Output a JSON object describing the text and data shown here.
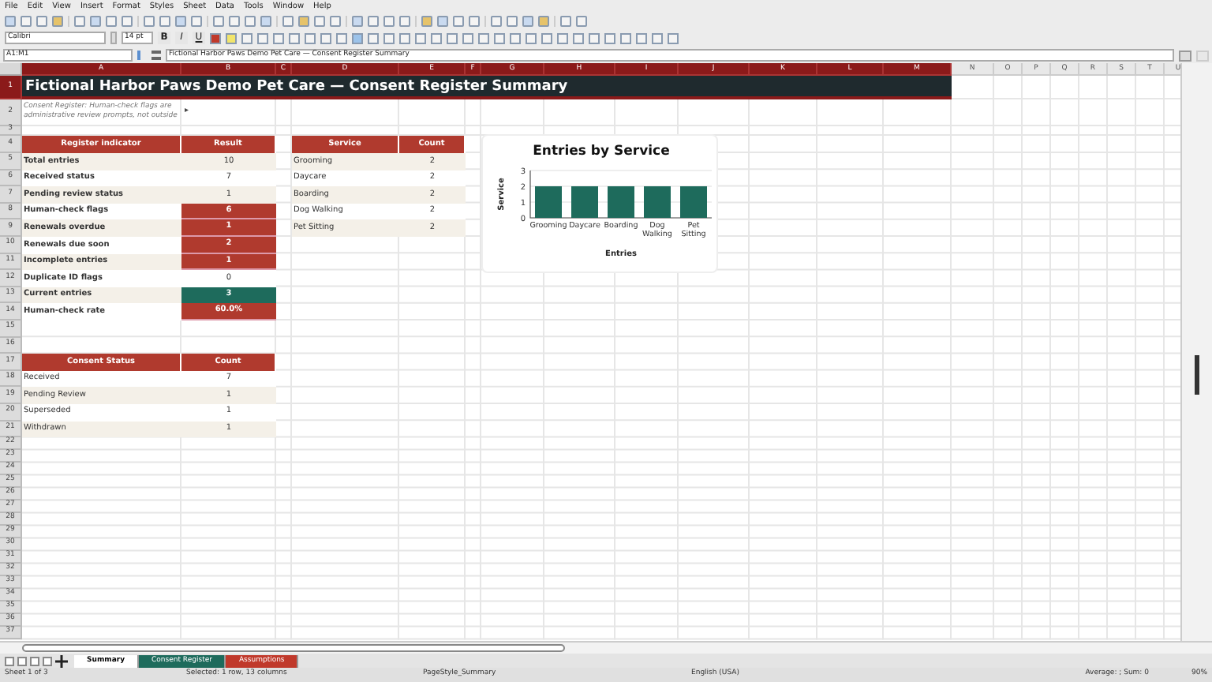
{
  "menu": [
    "File",
    "Edit",
    "View",
    "Insert",
    "Format",
    "Styles",
    "Sheet",
    "Data",
    "Tools",
    "Window",
    "Help"
  ],
  "font_name": "Calibri",
  "font_size": "14 pt",
  "format_buttons": [
    "B",
    "I",
    "U"
  ],
  "name_box": "A1:M1",
  "formula": "Fictional Harbor Paws Demo Pet Care — Consent Register Summary",
  "columns": [
    {
      "label": "A",
      "selected": true
    },
    {
      "label": "B",
      "selected": true
    },
    {
      "label": "C",
      "selected": true
    },
    {
      "label": "D",
      "selected": true
    },
    {
      "label": "E",
      "selected": true
    },
    {
      "label": "F",
      "selected": true
    },
    {
      "label": "G",
      "selected": true
    },
    {
      "label": "H",
      "selected": true
    },
    {
      "label": "I",
      "selected": true
    },
    {
      "label": "J",
      "selected": true
    },
    {
      "label": "K",
      "selected": true
    },
    {
      "label": "L",
      "selected": true
    },
    {
      "label": "M",
      "selected": true
    },
    {
      "label": "N",
      "selected": false
    },
    {
      "label": "O",
      "selected": false
    },
    {
      "label": "P",
      "selected": false
    },
    {
      "label": "Q",
      "selected": false
    },
    {
      "label": "R",
      "selected": false
    },
    {
      "label": "S",
      "selected": false
    },
    {
      "label": "T",
      "selected": false
    },
    {
      "label": "U",
      "selected": false
    }
  ],
  "rows": [
    {
      "label": "1",
      "selected": true
    },
    {
      "label": "2",
      "selected": false
    },
    {
      "label": "3",
      "selected": false
    },
    {
      "label": "4",
      "selected": false
    },
    {
      "label": "5",
      "selected": false
    },
    {
      "label": "6",
      "selected": false
    },
    {
      "label": "7",
      "selected": false
    },
    {
      "label": "8",
      "selected": false
    },
    {
      "label": "9",
      "selected": false
    },
    {
      "label": "10",
      "selected": false
    },
    {
      "label": "11",
      "selected": false
    },
    {
      "label": "12",
      "selected": false
    },
    {
      "label": "13",
      "selected": false
    },
    {
      "label": "14",
      "selected": false
    },
    {
      "label": "15",
      "selected": false
    },
    {
      "label": "16",
      "selected": false
    },
    {
      "label": "17",
      "selected": false
    },
    {
      "label": "18",
      "selected": false
    },
    {
      "label": "19",
      "selected": false
    },
    {
      "label": "20",
      "selected": false
    },
    {
      "label": "21",
      "selected": false
    },
    {
      "label": "22",
      "selected": false
    },
    {
      "label": "23",
      "selected": false
    },
    {
      "label": "24",
      "selected": false
    },
    {
      "label": "25",
      "selected": false
    },
    {
      "label": "26",
      "selected": false
    },
    {
      "label": "27",
      "selected": false
    },
    {
      "label": "28",
      "selected": false
    },
    {
      "label": "29",
      "selected": false
    },
    {
      "label": "30",
      "selected": false
    },
    {
      "label": "31",
      "selected": false
    },
    {
      "label": "32",
      "selected": false
    },
    {
      "label": "33",
      "selected": false
    },
    {
      "label": "34",
      "selected": false
    },
    {
      "label": "35",
      "selected": false
    },
    {
      "label": "36",
      "selected": false
    },
    {
      "label": "37",
      "selected": false
    }
  ],
  "title": "Fictional Harbor Paws Demo Pet Care — Consent Register Summary",
  "note": "Consent Register: Human-check flags are administrative review prompts, not outside",
  "note_marker": "▸",
  "indicator_table": {
    "columns": [
      "Register indicator",
      "Result"
    ],
    "rows": [
      {
        "label": "Total entries",
        "value": "10",
        "kind": "plain"
      },
      {
        "label": "Received status",
        "value": "7",
        "kind": "plain"
      },
      {
        "label": "Pending review status",
        "value": "1",
        "kind": "plain"
      },
      {
        "label": "Human-check flags",
        "value": "6",
        "kind": "alert"
      },
      {
        "label": "Renewals overdue",
        "value": "1",
        "kind": "alert"
      },
      {
        "label": "Renewals due soon",
        "value": "2",
        "kind": "alert"
      },
      {
        "label": "Incomplete entries",
        "value": "1",
        "kind": "alert"
      },
      {
        "label": "Duplicate ID flags",
        "value": "0",
        "kind": "plain"
      },
      {
        "label": "Current entries",
        "value": "3",
        "kind": "good"
      },
      {
        "label": "Human-check rate",
        "value": "60.0%",
        "kind": "alert"
      }
    ]
  },
  "service_table": {
    "columns": [
      "Service",
      "Count"
    ],
    "rows": [
      {
        "label": "Grooming",
        "value": "2"
      },
      {
        "label": "Daycare",
        "value": "2"
      },
      {
        "label": "Boarding",
        "value": "2"
      },
      {
        "label": "Dog Walking",
        "value": "2"
      },
      {
        "label": "Pet Sitting",
        "value": "2"
      }
    ]
  },
  "consent_table": {
    "columns": [
      "Consent Status",
      "Count"
    ],
    "rows": [
      {
        "label": "Received",
        "value": "7"
      },
      {
        "label": "Pending Review",
        "value": "1"
      },
      {
        "label": "Superseded",
        "value": "1"
      },
      {
        "label": "Withdrawn",
        "value": "1"
      }
    ]
  },
  "chart_data": {
    "type": "bar",
    "title": "Entries by Service",
    "xlabel": "Entries",
    "ylabel": "Service",
    "categories": [
      "Grooming",
      "Daycare",
      "Boarding",
      "Dog Walking",
      "Pet Sitting"
    ],
    "values": [
      2,
      2,
      2,
      2,
      2
    ],
    "ylim": [
      0,
      3
    ],
    "yticks": [
      0,
      1,
      2,
      3
    ]
  },
  "sheet_tabs": [
    {
      "label": "Summary",
      "selected": true,
      "color": "#ffffff"
    },
    {
      "label": "Consent Register",
      "selected": false,
      "color": "#1e6b5c"
    },
    {
      "label": "Assumptions",
      "selected": false,
      "color": "#c0392b"
    }
  ],
  "status_bar": {
    "sheet": "Sheet 1 of 3",
    "selection": "Selected: 1 row, 13 columns",
    "page_style": "PageStyle_Summary",
    "language": "English (USA)",
    "sum": "Average: ; Sum: 0",
    "zoom": "90%"
  }
}
